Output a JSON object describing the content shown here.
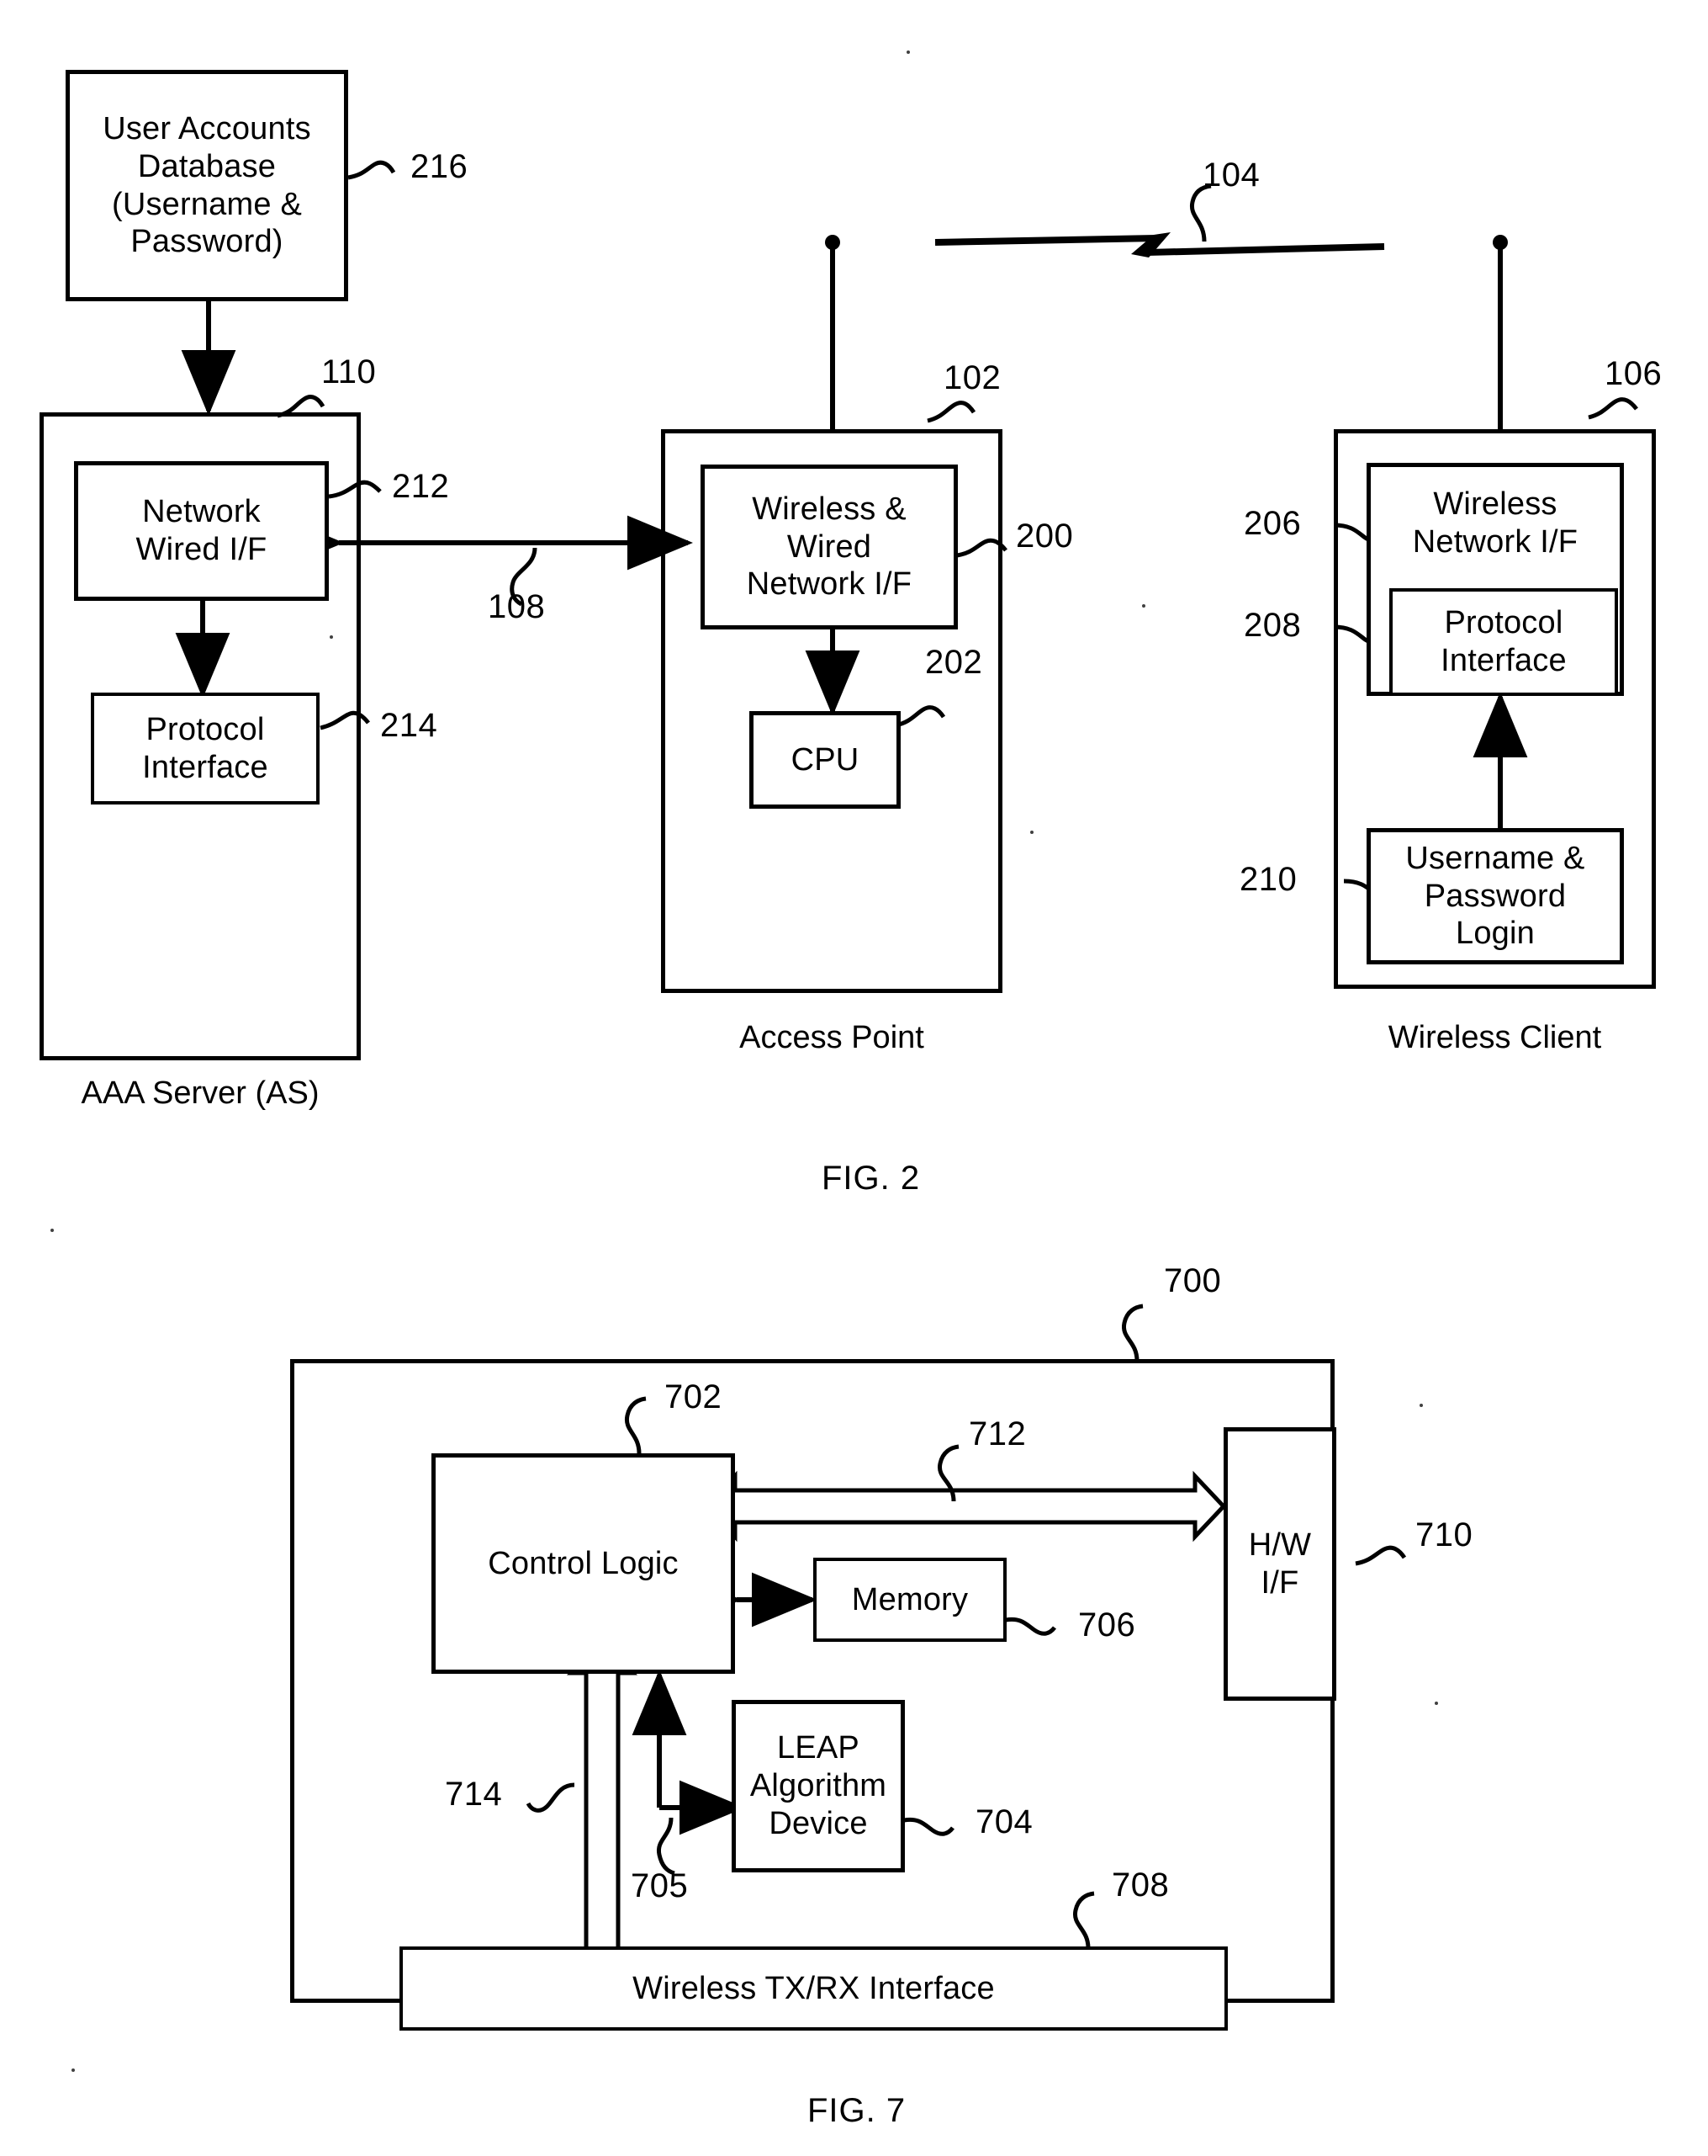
{
  "document": {
    "type": "patent-drawing-sheet",
    "figures": [
      "FIG. 2",
      "FIG. 7"
    ]
  },
  "fig2": {
    "label": "FIG. 2",
    "boxes": {
      "user_accounts_db": "User Accounts\nDatabase\n(Username &\nPassword)",
      "network_wired_if": "Network\nWired I/F",
      "protocol_interface_as": "Protocol\nInterface",
      "wireless_wired_network_if": "Wireless &\nWired\nNetwork I/F",
      "cpu": "CPU",
      "wireless_network_if": "Wireless\nNetwork I/F",
      "protocol_interface_client": "Protocol\nInterface",
      "username_password_login": "Username &\nPassword\nLogin"
    },
    "captions": {
      "aaa_server": "AAA Server (AS)",
      "access_point": "Access Point",
      "wireless_client": "Wireless Client"
    },
    "refs": {
      "r216": "216",
      "r110": "110",
      "r212": "212",
      "r214": "214",
      "r108": "108",
      "r102": "102",
      "r200": "200",
      "r202": "202",
      "r104": "104",
      "r106": "106",
      "r206": "206",
      "r208": "208",
      "r210": "210"
    }
  },
  "fig7": {
    "label": "FIG. 7",
    "boxes": {
      "control_logic": "Control Logic",
      "memory": "Memory",
      "leap_algorithm_device": "LEAP\nAlgorithm\nDevice",
      "hw_if": "H/W\nI/F",
      "wireless_tx_rx_interface": "Wireless TX/RX Interface"
    },
    "refs": {
      "r700": "700",
      "r702": "702",
      "r704": "704",
      "r705": "705",
      "r706": "706",
      "r708": "708",
      "r710": "710",
      "r712": "712",
      "r714": "714"
    }
  },
  "colors": {
    "ink": "#000000",
    "paper": "#ffffff"
  }
}
